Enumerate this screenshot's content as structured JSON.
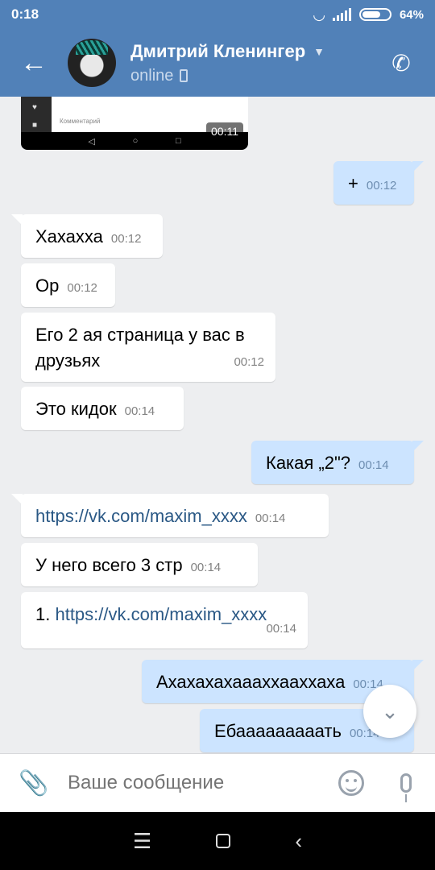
{
  "status": {
    "time": "0:18",
    "battery": "64%"
  },
  "header": {
    "name": "Дмитрий Кленингер",
    "status": "online"
  },
  "video": {
    "comment_placeholder": "Комментарий",
    "duration": "00:11"
  },
  "messages": [
    {
      "dir": "out",
      "text": "+",
      "time": "00:12"
    },
    {
      "dir": "in",
      "text": "Хахахха",
      "time": "00:12"
    },
    {
      "dir": "in",
      "text": "Ор",
      "time": "00:12"
    },
    {
      "dir": "in",
      "text": "Его 2 ая страница у вас в друзьях",
      "time": "00:12"
    },
    {
      "dir": "in",
      "text": "Это кидок",
      "time": "00:14"
    },
    {
      "dir": "out",
      "text": "Какая „2\"?",
      "time": "00:14"
    },
    {
      "dir": "in",
      "link": "https://vk.com/maxim_xxxx",
      "time": "00:14"
    },
    {
      "dir": "in",
      "text": "У него всего  3 стр",
      "time": "00:14"
    },
    {
      "dir": "in",
      "prefix": "1. ",
      "link": "https://vk.com/maxim_xxxx",
      "time": "00:14"
    },
    {
      "dir": "out",
      "text": "Ахахахахаааххааххаха",
      "time": "00:14"
    },
    {
      "dir": "out",
      "text": "Ебааааааааать",
      "time": "00:14"
    }
  ],
  "composer": {
    "placeholder": "Ваше сообщение"
  },
  "icons": {
    "back": "arrow-left-icon",
    "call": "phone-icon",
    "attach": "paperclip-icon",
    "emoji": "smile-icon",
    "mic": "microphone-icon",
    "scroll": "chevron-down-icon"
  },
  "colors": {
    "header": "#5181b8",
    "outgoing": "#cce4ff",
    "incoming": "#ffffff",
    "link": "#2a5885"
  }
}
